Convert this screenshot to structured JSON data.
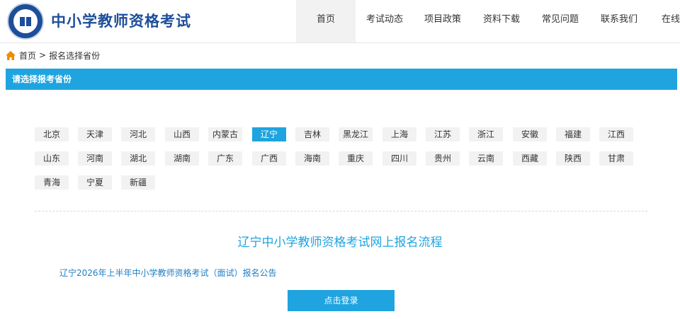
{
  "header": {
    "site_title": "中小学教师资格考试",
    "nav": [
      "首页",
      "考试动态",
      "项目政策",
      "资料下载",
      "常见问题",
      "联系我们",
      "在线客服"
    ]
  },
  "breadcrumb": {
    "home": "首页",
    "separator": ">",
    "current": "报名选择省份"
  },
  "section": {
    "title": "请选择报考省份"
  },
  "provinces": {
    "selected": "辽宁",
    "rows": [
      [
        "北京",
        "天津",
        "河北",
        "山西",
        "内蒙古",
        "辽宁",
        "吉林",
        "黑龙江",
        "上海",
        "江苏",
        "浙江",
        "安徽",
        "福建",
        "江西"
      ],
      [
        "山东",
        "河南",
        "湖北",
        "湖南",
        "广东",
        "广西",
        "海南",
        "重庆",
        "四川",
        "贵州",
        "云南",
        "西藏",
        "陕西",
        "甘肃"
      ],
      [
        "青海",
        "宁夏",
        "新疆"
      ]
    ]
  },
  "content": {
    "flow_title": "辽宁中小学教师资格考试网上报名流程",
    "notice_link": "辽宁2026年上半年中小学教师资格考试（面试）报名公告",
    "login_button": "点击登录"
  },
  "colors": {
    "accent": "#1fa4e0",
    "brand": "#1d4e9a",
    "nav_active_bg": "#f2f2f2",
    "province_bg": "#f2f2f2"
  }
}
